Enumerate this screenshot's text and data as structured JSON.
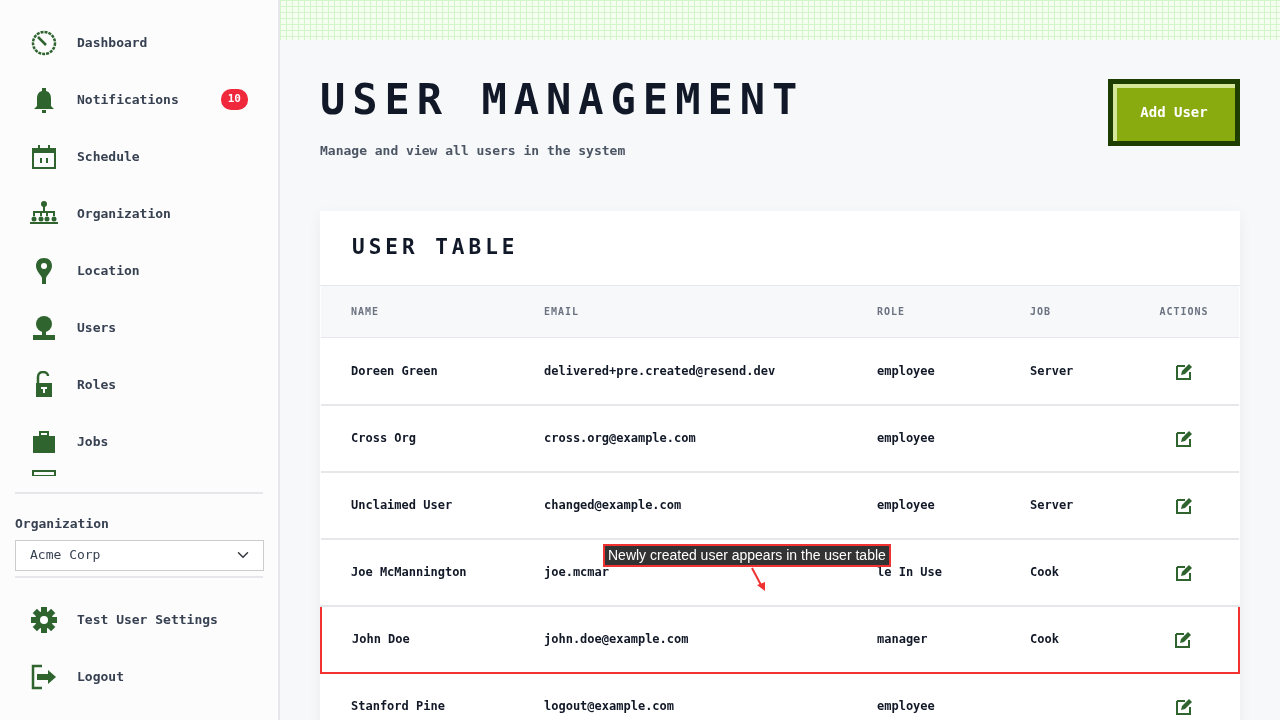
{
  "sidebar": {
    "items": [
      {
        "label": "Dashboard"
      },
      {
        "label": "Notifications",
        "badge": "10"
      },
      {
        "label": "Schedule"
      },
      {
        "label": "Organization"
      },
      {
        "label": "Location"
      },
      {
        "label": "Users"
      },
      {
        "label": "Roles"
      },
      {
        "label": "Jobs"
      }
    ],
    "organization": {
      "label": "Organization",
      "value": "Acme Corp"
    },
    "footer_items": [
      {
        "label": "Test User Settings"
      },
      {
        "label": "Logout"
      }
    ]
  },
  "header": {
    "title": "USER MANAGEMENT",
    "subtitle": "Manage and view all users in the system",
    "add_button": "Add User"
  },
  "table": {
    "title": "USER TABLE",
    "columns": [
      "NAME",
      "EMAIL",
      "ROLE",
      "JOB",
      "ACTIONS"
    ],
    "rows": [
      {
        "name": "Doreen Green",
        "email": "delivered+pre.created@resend.dev",
        "role": "employee",
        "job": "Server",
        "highlighted": false
      },
      {
        "name": "Cross Org",
        "email": "cross.org@example.com",
        "role": "employee",
        "job": "",
        "highlighted": false
      },
      {
        "name": "Unclaimed User",
        "email": "changed@example.com",
        "role": "employee",
        "job": "Server",
        "highlighted": false
      },
      {
        "name": "Joe McMannington",
        "email": "joe.mcmar",
        "role": "le In Use",
        "job": "Cook",
        "highlighted": false
      },
      {
        "name": "John Doe",
        "email": "john.doe@example.com",
        "role": "manager",
        "job": "Cook",
        "highlighted": true
      },
      {
        "name": "Stanford Pine",
        "email": "logout@example.com",
        "role": "employee",
        "job": "",
        "highlighted": false
      }
    ]
  },
  "annotation": {
    "text": "Newly created user appears in the user table"
  }
}
